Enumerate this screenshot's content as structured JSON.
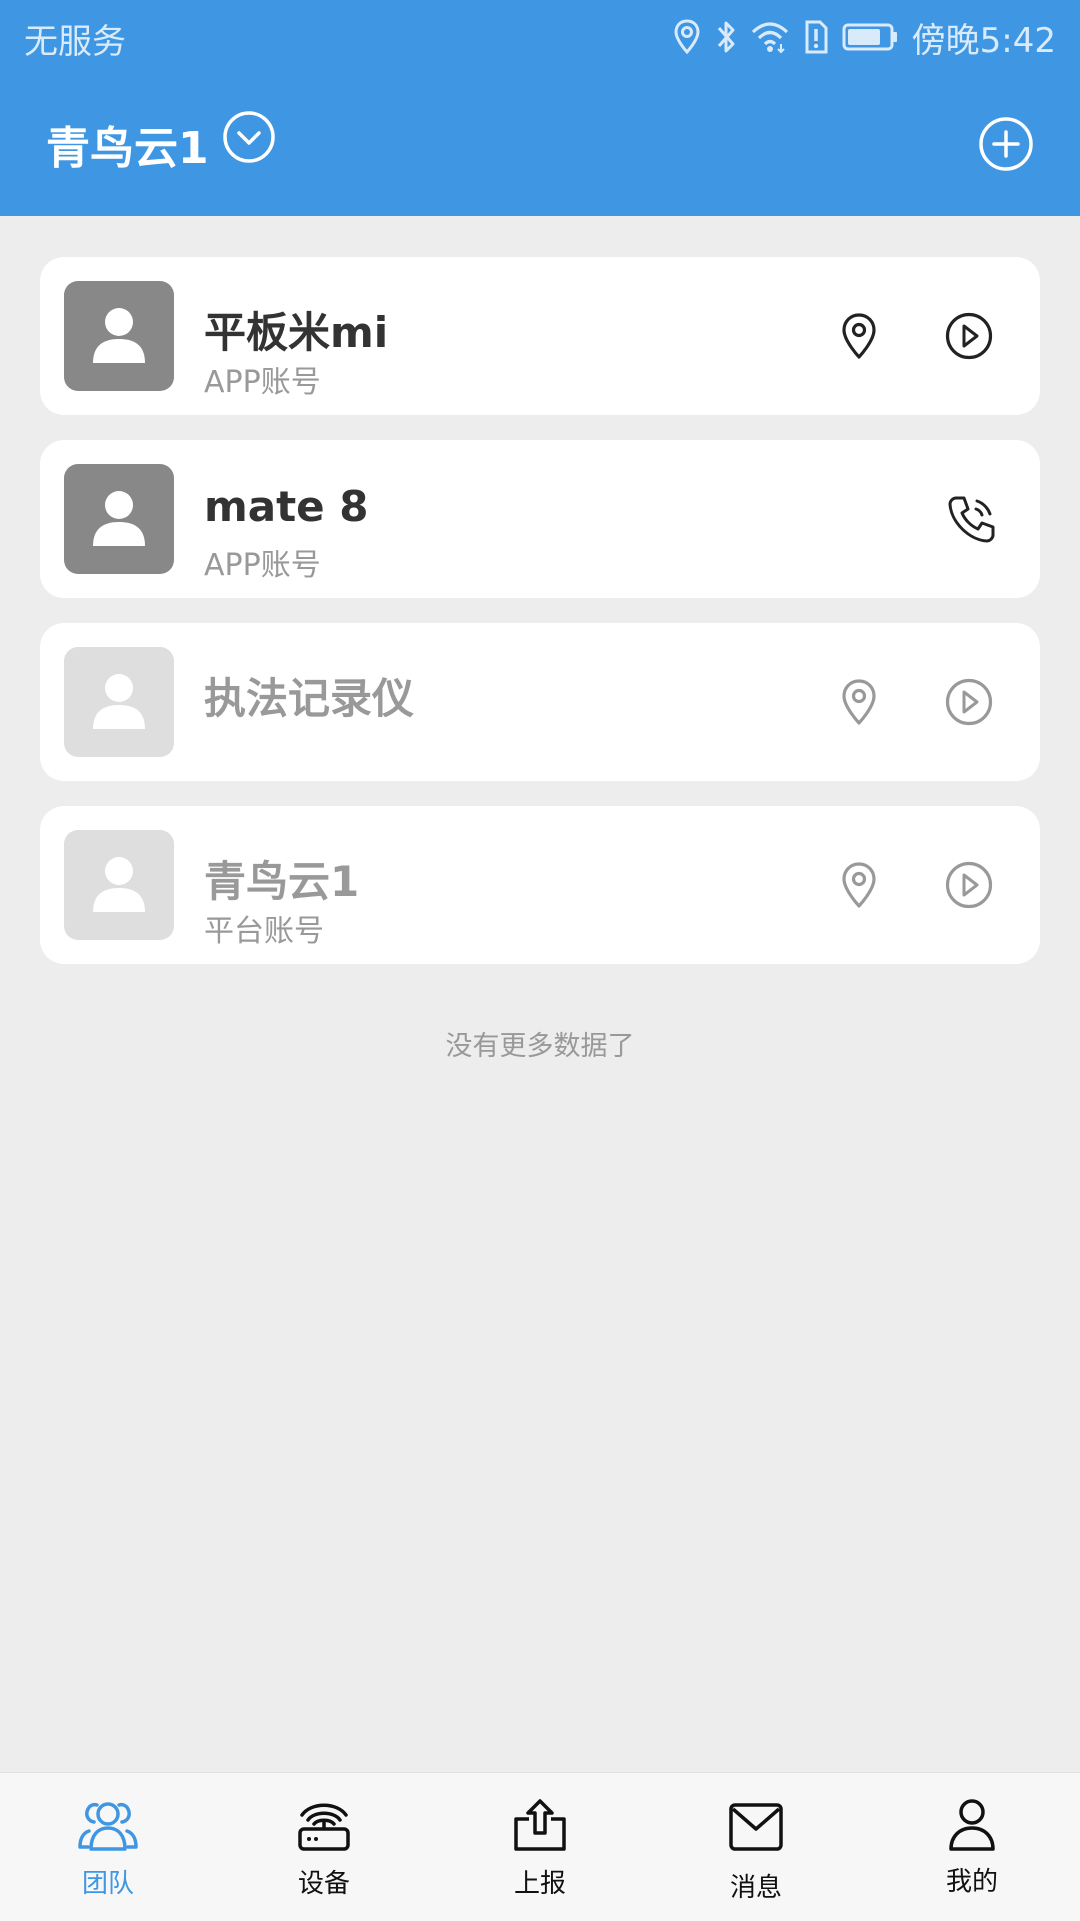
{
  "status_bar": {
    "carrier": "无服务",
    "time": "傍晚5:42"
  },
  "app_bar": {
    "title": "青鸟云1",
    "dropdown_icon": "chevron-down-circle-icon",
    "add_icon": "plus-circle-icon"
  },
  "members": [
    {
      "name": "平板米mi",
      "subtitle": "APP账号",
      "active": true,
      "actions": [
        "location-icon",
        "play-icon"
      ]
    },
    {
      "name": "mate 8",
      "subtitle": "APP账号",
      "active": true,
      "actions": [
        "phone-call-icon"
      ]
    },
    {
      "name": "执法记录仪",
      "subtitle": "",
      "active": false,
      "actions": [
        "location-icon",
        "play-icon"
      ]
    },
    {
      "name": "青鸟云1",
      "subtitle": "平台账号",
      "active": false,
      "actions": [
        "location-icon",
        "play-icon"
      ]
    }
  ],
  "empty_hint": "没有更多数据了",
  "bottom_nav": {
    "items": [
      {
        "label": "团队",
        "icon": "team-icon",
        "active": true
      },
      {
        "label": "设备",
        "icon": "device-icon",
        "active": false
      },
      {
        "label": "上报",
        "icon": "upload-icon",
        "active": false
      },
      {
        "label": "消息",
        "icon": "mail-icon",
        "active": false
      },
      {
        "label": "我的",
        "icon": "user-icon",
        "active": false
      }
    ]
  },
  "colors": {
    "primary": "#3f96e2",
    "background": "#ededed",
    "text_dark": "#333333",
    "text_muted": "#999999"
  }
}
